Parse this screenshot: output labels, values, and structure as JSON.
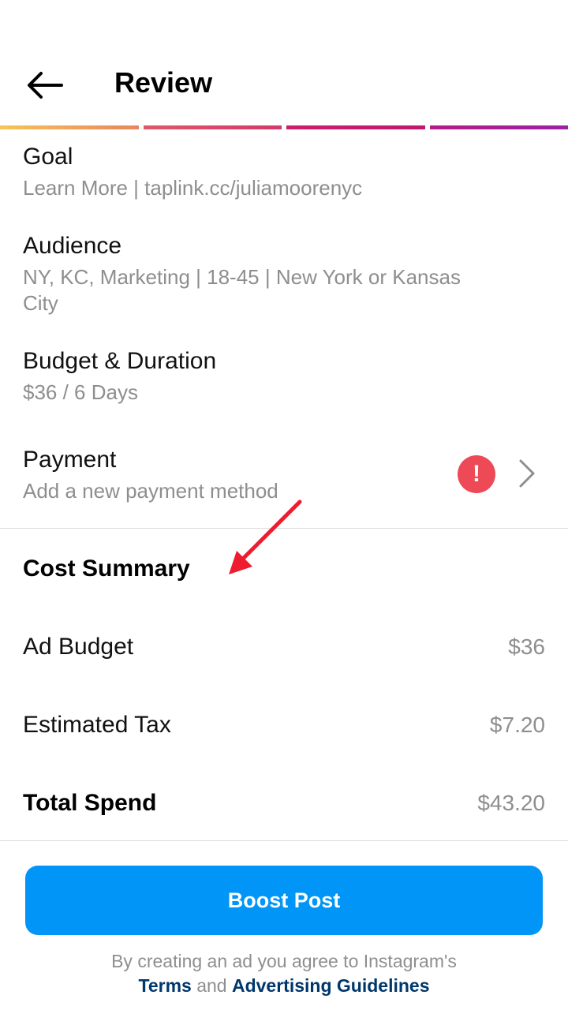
{
  "header": {
    "title": "Review",
    "back_icon": "arrow-left-icon"
  },
  "progress": {
    "colors": [
      "#f6c45a",
      "#e1306c",
      "#c2185b",
      "#a020a0"
    ],
    "steps_total": 4,
    "steps_complete": 4
  },
  "review": {
    "goal": {
      "title": "Goal",
      "value": "Learn More | taplink.cc/juliamoorenyc"
    },
    "audience": {
      "title": "Audience",
      "value": "NY, KC, Marketing | 18-45 | New York or Kansas City"
    },
    "budget": {
      "title": "Budget & Duration",
      "value": "$36 / 6 Days"
    },
    "payment": {
      "title": "Payment",
      "value": "Add a new payment method",
      "alert_symbol": "!",
      "alert_icon": "error-alert-icon",
      "chevron_icon": "chevron-right-icon"
    }
  },
  "cost_summary": {
    "title": "Cost Summary",
    "ad_budget": {
      "label": "Ad Budget",
      "value": "$36"
    },
    "tax": {
      "label": "Estimated Tax",
      "value": "$7.20"
    },
    "total": {
      "label": "Total Spend",
      "value": "$43.20"
    }
  },
  "actions": {
    "boost_label": "Boost Post"
  },
  "legal": {
    "prefix": "By creating an ad you agree to Instagram's",
    "terms": "Terms",
    "and": "and",
    "guidelines": "Advertising Guidelines"
  },
  "colors": {
    "primary": "#0095f6",
    "alert": "#ed4956",
    "link": "#00376b",
    "secondary_text": "#8e8e8e",
    "annotation": "#ee1c2e"
  }
}
